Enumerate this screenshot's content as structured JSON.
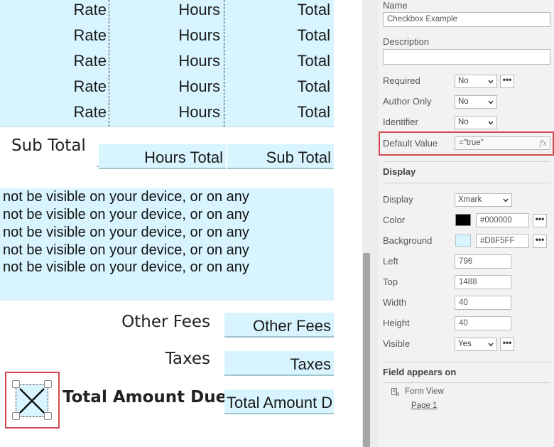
{
  "canvas": {
    "rows": [
      {
        "rate": "Rate",
        "hours": "Hours",
        "total": "Total"
      },
      {
        "rate": "Rate",
        "hours": "Hours",
        "total": "Total"
      },
      {
        "rate": "Rate",
        "hours": "Hours",
        "total": "Total"
      },
      {
        "rate": "Rate",
        "hours": "Hours",
        "total": "Total"
      },
      {
        "rate": "Rate",
        "hours": "Hours",
        "total": "Total"
      }
    ],
    "subtotal_label": "Sub Total",
    "hours_total_field": "Hours Total",
    "sub_total_field": "Sub Total",
    "text_lines": [
      "not be visible on your device, or on any",
      "not be visible on your device, or on any",
      "not be visible on your device, or on any",
      "not be visible on your device, or on any",
      "not be visible on your device, or on any"
    ],
    "other_fees_label": "Other Fees",
    "other_fees_field": "Other Fees",
    "taxes_label": "Taxes",
    "taxes_field": "Taxes",
    "total_due_label": "Total Amount Due",
    "total_due_field": "Total Amount D"
  },
  "panel": {
    "name_label": "Name",
    "name_value": "Checkbox Example",
    "description_label": "Description",
    "description_value": "",
    "required_label": "Required",
    "required_value": "No",
    "author_only_label": "Author Only",
    "author_only_value": "No",
    "identifier_label": "Identifier",
    "identifier_value": "No",
    "default_value_label": "Default Value",
    "default_value": "=\"true\"",
    "fx_label": "fx",
    "display_section": "Display",
    "display_label": "Display",
    "display_value": "Xmark",
    "color_label": "Color",
    "color_value": "#000000",
    "background_label": "Background",
    "background_value": "#D8F5FF",
    "left_label": "Left",
    "left_value": "796",
    "top_label": "Top",
    "top_value": "1488",
    "width_label": "Width",
    "width_value": "40",
    "height_label": "Height",
    "height_value": "40",
    "visible_label": "Visible",
    "visible_value": "Yes",
    "field_appears_on": "Field appears on",
    "form_view": "Form View",
    "page_link": "Page 1",
    "dots": "•••"
  },
  "colors": {
    "accent_red": "#d14a4f",
    "field_bg": "#d8f5ff",
    "swatch_color": "#000000",
    "swatch_background": "#D8F5FF"
  }
}
